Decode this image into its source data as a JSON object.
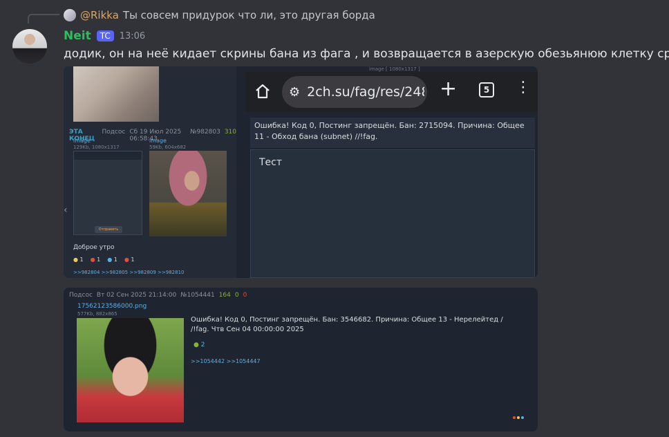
{
  "reply": {
    "username": "@Rikka",
    "text": "Ты совсем придурок что ли, это другая борда"
  },
  "message": {
    "username": "Neit",
    "tag": "TC",
    "time": "13:06",
    "content": "додик, он на неё кидает скрины бана из фага , и возвращается в азерскую обезьянюю клетку срать"
  },
  "attachment1": {
    "top_caption": "image [ 1080x1317 ]",
    "post": {
      "name": "ЭТА КОНЕЦ",
      "sage": "Подсос",
      "date": "Сб 19 Июл 2025 06:58:43",
      "number": "№982803",
      "count": "310",
      "image_label_left": "image",
      "image_meta_left": "129Kb, 1080x1317",
      "image_label_right": "image",
      "image_meta_right": "59Kb, 604x682",
      "mini_send": "Отправить",
      "text": "Доброе утро",
      "reactions": [
        "1",
        "1",
        "1",
        "1"
      ],
      "links": ">>982804 >>982805 >>982809 >>982810"
    },
    "browser": {
      "url": "2ch.su/fag/res/248",
      "tab_count": "5",
      "error": "Ошибка! Код 0, Постинг запрещён. Бан: 2715094. Причина: Общее 11 - Обход бана (subnet) //!fag.",
      "textarea": "Тест"
    }
  },
  "attachment2": {
    "sage": "Подсос",
    "date": "Вт 02 Сен 2025 21:14:00",
    "number": "№1054441",
    "count": "164",
    "likes": "0",
    "dislikes": "0",
    "file_name": "17562123586000.png",
    "file_meta": "577Kb, 882x865",
    "text": "Ошибка! Код 0, Постинг запрещён. Бан: 3546682. Причина: Общее 13 - Нерелейтед / /!fag. Чтв Сен 04 00:00:00 2025",
    "reaction": "2",
    "links": ">>1054442 >>1054447"
  },
  "colors": {
    "background": "#313338",
    "username": "#2fbd5f",
    "reply_name": "#e0a55f",
    "tag_bg": "#5865f2",
    "link": "#5ab1e8"
  },
  "icons": [
    "home-icon",
    "tune-icon",
    "plus-icon",
    "tabs-icon",
    "menu-icon"
  ]
}
